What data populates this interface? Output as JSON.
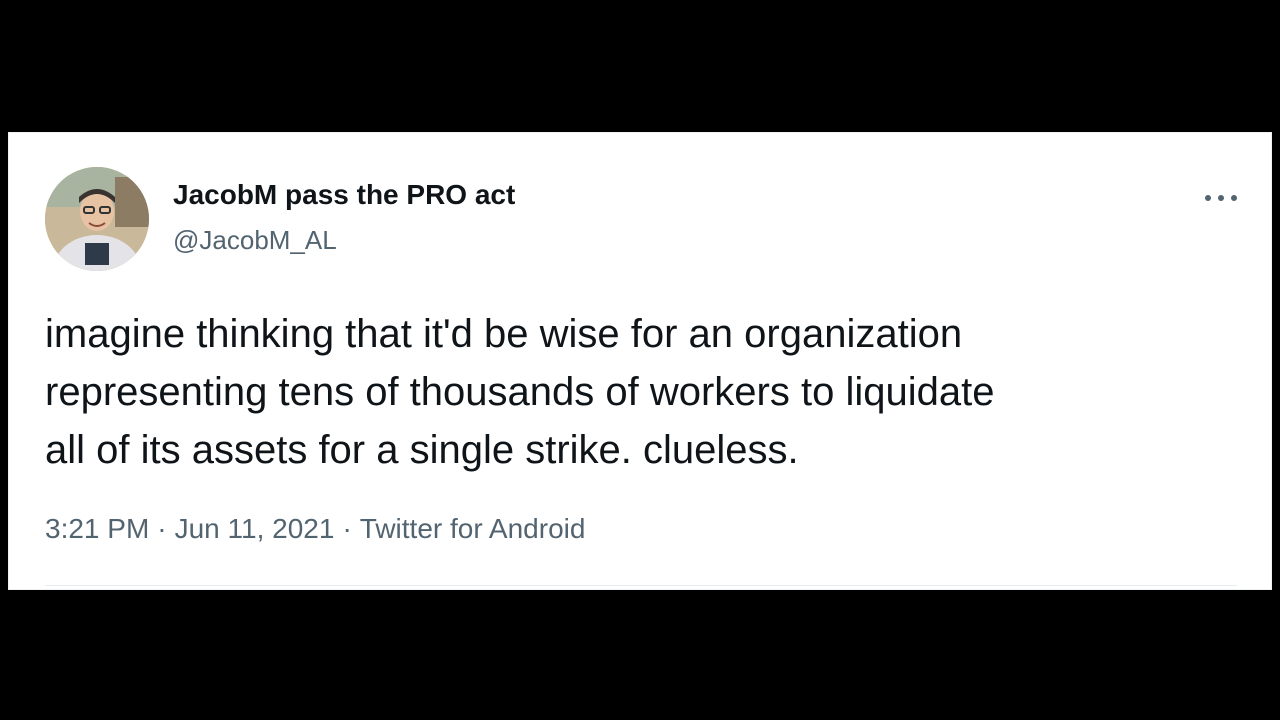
{
  "tweet": {
    "display_name": "JacobM pass the PRO act",
    "handle": "@JacobM_AL",
    "text_lines": [
      "imagine thinking that it'd be wise for an organization",
      "representing tens of thousands of workers to liquidate",
      "all of its assets for a single strike. clueless."
    ],
    "time": "3:21 PM",
    "date": "Jun 11, 2021",
    "source": "Twitter for Android",
    "separator": "·",
    "more_icon": "more-dots-icon"
  },
  "colors": {
    "background": "#000000",
    "card": "#ffffff",
    "text_primary": "#0f1419",
    "text_secondary": "#536471"
  }
}
